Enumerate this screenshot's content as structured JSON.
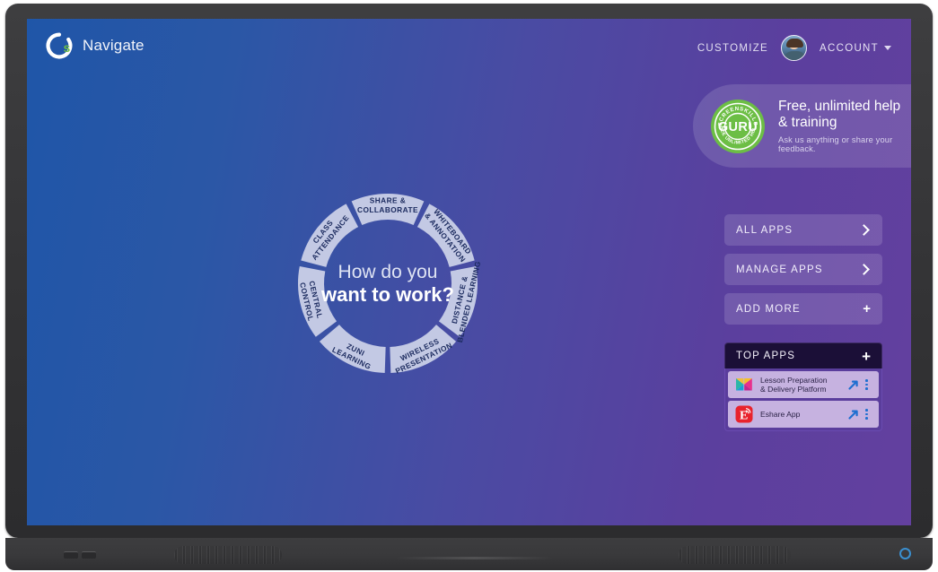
{
  "device": {
    "power_indicator": "power-led",
    "ports": [
      "usb-port",
      "usb-port"
    ],
    "speakers": [
      "speaker-grille-left",
      "speaker-grille-right"
    ]
  },
  "topbar": {
    "brand_name": "Navigate",
    "brand_logo_icon": "clevershare-c-logo",
    "customize_label": "CUSTOMIZE",
    "account_label": "ACCOUNT",
    "account_chevron_icon": "chevron-down-icon",
    "avatar_icon": "user-avatar-photo"
  },
  "guru": {
    "badge_top_arc": "SCREENSKILLS",
    "badge_center": "GURU",
    "badge_bottom_arc": "FREE UNLIMITED HELP",
    "title_line1": "Free, unlimited help",
    "title_line2": "& training",
    "subtitle": "Ask us anything or share your feedback.",
    "badge_color": "#6cbe45"
  },
  "menu": {
    "items": [
      {
        "label": "ALL APPS",
        "icon": "chevron-right-icon"
      },
      {
        "label": "MANAGE APPS",
        "icon": "chevron-right-icon"
      },
      {
        "label": "ADD MORE",
        "icon": "plus-icon"
      }
    ]
  },
  "top_apps": {
    "title": "TOP APPS",
    "add_icon": "plus-icon",
    "header_color": "#1b0f37",
    "apps": [
      {
        "name": "Lesson Preparation\n& Delivery Platform",
        "name_line1": "Lesson Preparation",
        "name_line2": "& Delivery Platform",
        "icon": "butterfly-app-icon",
        "launch_icon": "launch-arrow-icon",
        "menu_icon": "three-dot-menu-icon"
      },
      {
        "name": "Eshare App",
        "name_line1": "Eshare App",
        "name_line2": "",
        "icon": "eshare-e-icon",
        "launch_icon": "launch-arrow-icon",
        "menu_icon": "three-dot-menu-icon"
      }
    ]
  },
  "wheel": {
    "center_line1": "How do you",
    "center_line2": "want to work?",
    "segments": [
      {
        "id": "share-collaborate",
        "lines": [
          "SHARE &",
          "COLLABORATE"
        ]
      },
      {
        "id": "whiteboard-annotation",
        "lines": [
          "WHITEBOARD",
          "& ANNOTATION"
        ]
      },
      {
        "id": "distance-blended-learning",
        "lines": [
          "DISTANCE &",
          "BLENDED LEARNING"
        ]
      },
      {
        "id": "wireless-presentation",
        "lines": [
          "WIRELESS",
          "PRESENTATION"
        ]
      },
      {
        "id": "zuni-learning",
        "lines": [
          "ZUNI",
          "LEARNING"
        ]
      },
      {
        "id": "central-control",
        "lines": [
          "CENTRAL",
          "CONTROL"
        ]
      },
      {
        "id": "class-attendance",
        "lines": [
          "CLASS",
          "ATTENDANCE"
        ]
      }
    ]
  },
  "colors": {
    "bg_left": "#1f56a8",
    "bg_right": "#63409f",
    "segment_fill": "#c3c9e4",
    "accent_blue": "#1f6fd0",
    "bezel": "#39393b"
  }
}
